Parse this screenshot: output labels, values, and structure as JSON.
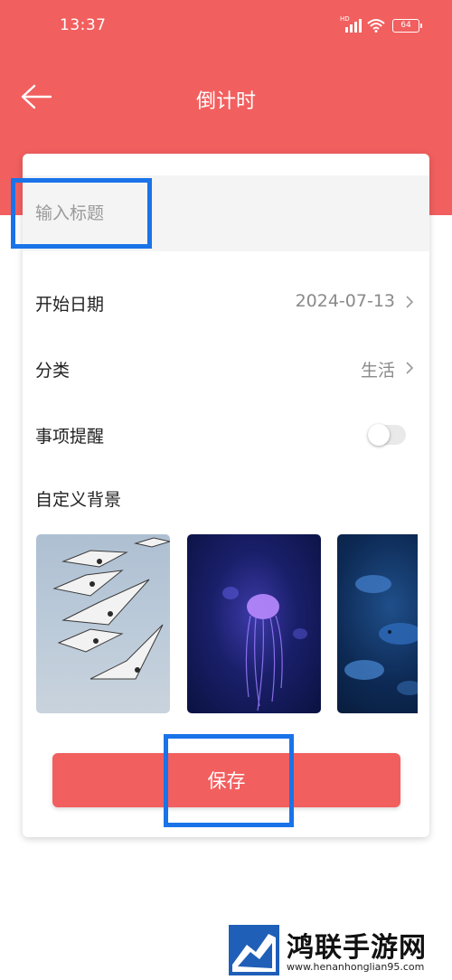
{
  "status_bar": {
    "time": "13:37",
    "network_label": "HD",
    "battery": "64"
  },
  "nav": {
    "title": "倒计时",
    "back_icon": "arrow-left-icon"
  },
  "form": {
    "title_placeholder": "输入标题",
    "title_value": "",
    "start_date": {
      "label": "开始日期",
      "value": "2024-07-13"
    },
    "category": {
      "label": "分类",
      "value": "生活"
    },
    "reminder": {
      "label": "事项提醒",
      "enabled": false
    },
    "background": {
      "label": "自定义背景",
      "thumbnails": [
        "seagulls-image",
        "jellyfish-image",
        "fish-image"
      ]
    },
    "save_label": "保存"
  },
  "watermark": {
    "title": "鸿联手游网",
    "url": "www.henanhonglian95.com"
  },
  "colors": {
    "accent": "#f25f5f",
    "highlight": "#1a73e8"
  }
}
